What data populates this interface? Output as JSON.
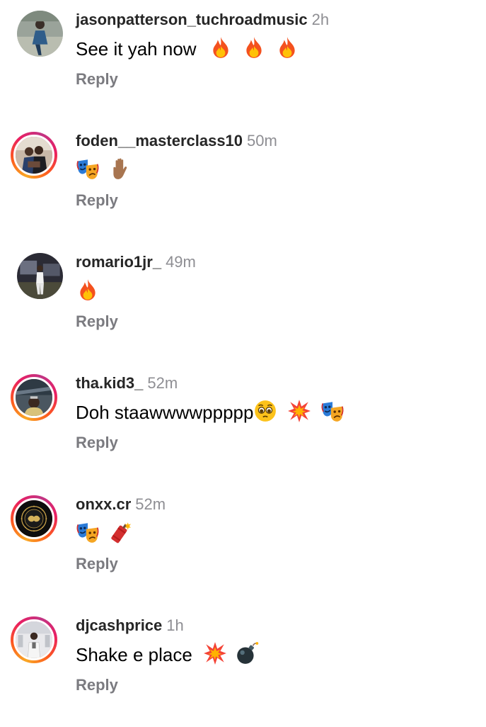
{
  "comments": [
    {
      "username": "jasonpatterson_tuchroadmusic",
      "time": "2h",
      "text": "See it yah now",
      "emoji": [
        "fire-emoji",
        "fire-emoji",
        "fire-emoji"
      ],
      "reply_label": "Reply",
      "story_ring": false
    },
    {
      "username": "foden__masterclass10",
      "time": "50m",
      "text": "",
      "emoji": [
        "performing-arts-emoji",
        "raised-hand-emoji"
      ],
      "reply_label": "Reply",
      "story_ring": true
    },
    {
      "username": "romario1jr_",
      "time": "49m",
      "text": "",
      "emoji": [
        "fire-emoji"
      ],
      "reply_label": "Reply",
      "story_ring": false
    },
    {
      "username": "tha.kid3_",
      "time": "52m",
      "text": "Doh staawwwwppppp",
      "emoji": [
        "pleading-face-emoji",
        "collision-emoji",
        "performing-arts-emoji"
      ],
      "reply_label": "Reply",
      "story_ring": true
    },
    {
      "username": "onxx.cr",
      "time": "52m",
      "text": "",
      "emoji": [
        "performing-arts-emoji",
        "firecracker-emoji"
      ],
      "reply_label": "Reply",
      "story_ring": true
    },
    {
      "username": "djcashprice",
      "time": "1h",
      "text": "Shake e place",
      "emoji": [
        "collision-emoji",
        "bomb-emoji"
      ],
      "reply_label": "Reply",
      "story_ring": true
    }
  ],
  "colors": {
    "username": "#262626",
    "timestamp": "#8e8e93",
    "reply": "#7b7b80",
    "ring_start": "#f9a825",
    "ring_end": "#c13584"
  }
}
